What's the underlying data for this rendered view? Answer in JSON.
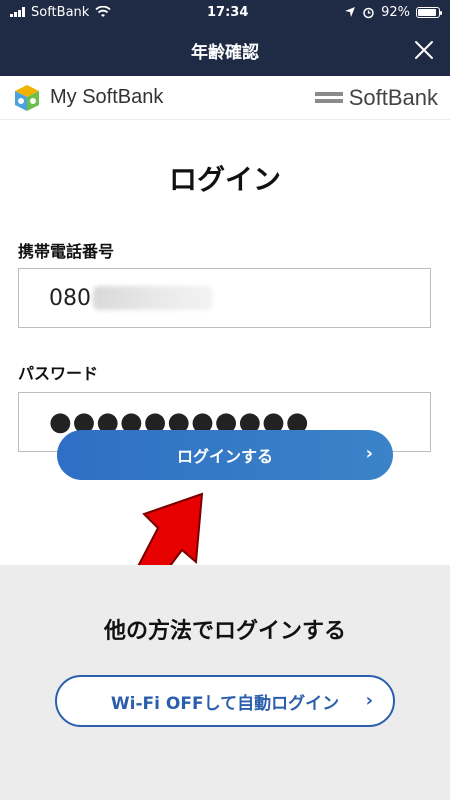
{
  "status_bar": {
    "carrier": "SoftBank",
    "time": "17:34",
    "battery_percent": "92%",
    "battery_level": 0.92
  },
  "nav": {
    "title": "年齢確認",
    "close_icon": "close-icon"
  },
  "brand": {
    "my_softbank_label": "My SoftBank",
    "softbank_label": "SoftBank"
  },
  "login": {
    "heading": "ログイン",
    "phone_label": "携帯電話番号",
    "phone_value_visible": "080",
    "password_label": "パスワード",
    "password_mask": "●●●●●●●●●●●",
    "submit_label": "ログインする",
    "chevron": "›"
  },
  "other": {
    "heading": "他の方法でログインする",
    "wifi_button_label": "Wi-Fi OFFして自動ログイン",
    "chevron": "›"
  },
  "colors": {
    "nav_bg": "#1f2a44",
    "primary_blue": "#2f6fc4",
    "wifi_border": "#2b5fad",
    "arrow_red": "#e60000"
  }
}
